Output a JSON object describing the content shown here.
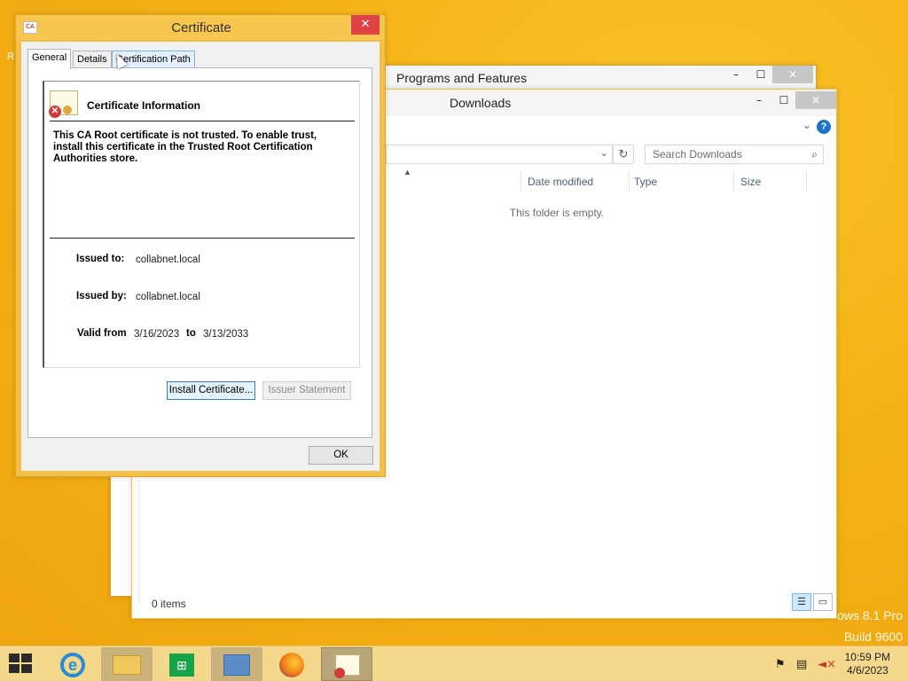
{
  "desktop": {
    "watermark_line1": "ows 8.1 Pro",
    "watermark_line2": "Build 9600",
    "icon_stub": "R"
  },
  "programs_window": {
    "title": "Programs and Features"
  },
  "downloads_window": {
    "title": "Downloads",
    "search_placeholder": "Search Downloads",
    "columns": [
      "Date modified",
      "Type",
      "Size"
    ],
    "empty_message": "This folder is empty.",
    "status": "0 items"
  },
  "certificate_dialog": {
    "title": "Certificate",
    "tabs": [
      "General",
      "Details",
      "Certification Path"
    ],
    "active_tab": "General",
    "info_heading": "Certificate Information",
    "warning": "This CA Root certificate is not trusted. To enable trust, install this certificate in the Trusted Root Certification Authorities store.",
    "issued_to_label": "Issued to:",
    "issued_to": "collabnet.local",
    "issued_by_label": "Issued by:",
    "issued_by": "collabnet.local",
    "valid_from_label": "Valid from",
    "valid_from": "3/16/2023",
    "to_label": "to",
    "valid_to": "3/13/2033",
    "install_button": "Install Certificate...",
    "issuer_button": "Issuer Statement",
    "ok_button": "OK"
  },
  "taskbar": {
    "time": "10:59 PM",
    "date": "4/6/2023"
  }
}
